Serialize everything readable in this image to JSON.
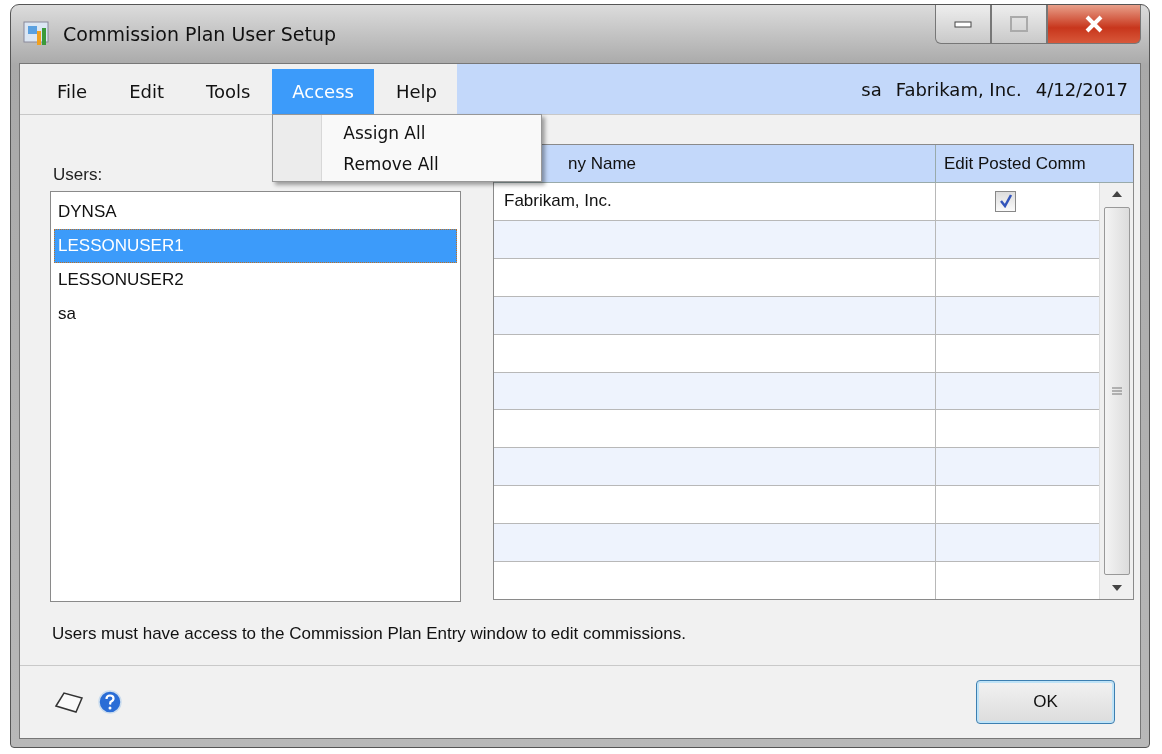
{
  "window": {
    "title": "Commission Plan User Setup"
  },
  "menu_bar": {
    "items": [
      {
        "label": "File",
        "selected": false
      },
      {
        "label": "Edit",
        "selected": false
      },
      {
        "label": "Tools",
        "selected": false
      },
      {
        "label": "Access",
        "selected": true
      },
      {
        "label": "Help",
        "selected": false
      }
    ],
    "info": {
      "user": "sa",
      "company": "Fabrikam, Inc.",
      "date": "4/12/2017"
    }
  },
  "access_menu": {
    "items": [
      "Assign All",
      "Remove All"
    ]
  },
  "users": {
    "label": "Users:",
    "items": [
      {
        "name": "DYNSA",
        "selected": false
      },
      {
        "name": "LESSONUSER1",
        "selected": true
      },
      {
        "name": "LESSONUSER2",
        "selected": false
      },
      {
        "name": "sa",
        "selected": false
      }
    ]
  },
  "grid": {
    "columns": [
      "ny Name",
      "Edit Posted Comm"
    ],
    "rows": [
      {
        "company_name": "Fabrikam, Inc.",
        "edit_posted_comm": true
      }
    ]
  },
  "note": "Users must have access to the Commission Plan Entry window to edit commissions.",
  "footer": {
    "ok_button": "OK"
  }
}
